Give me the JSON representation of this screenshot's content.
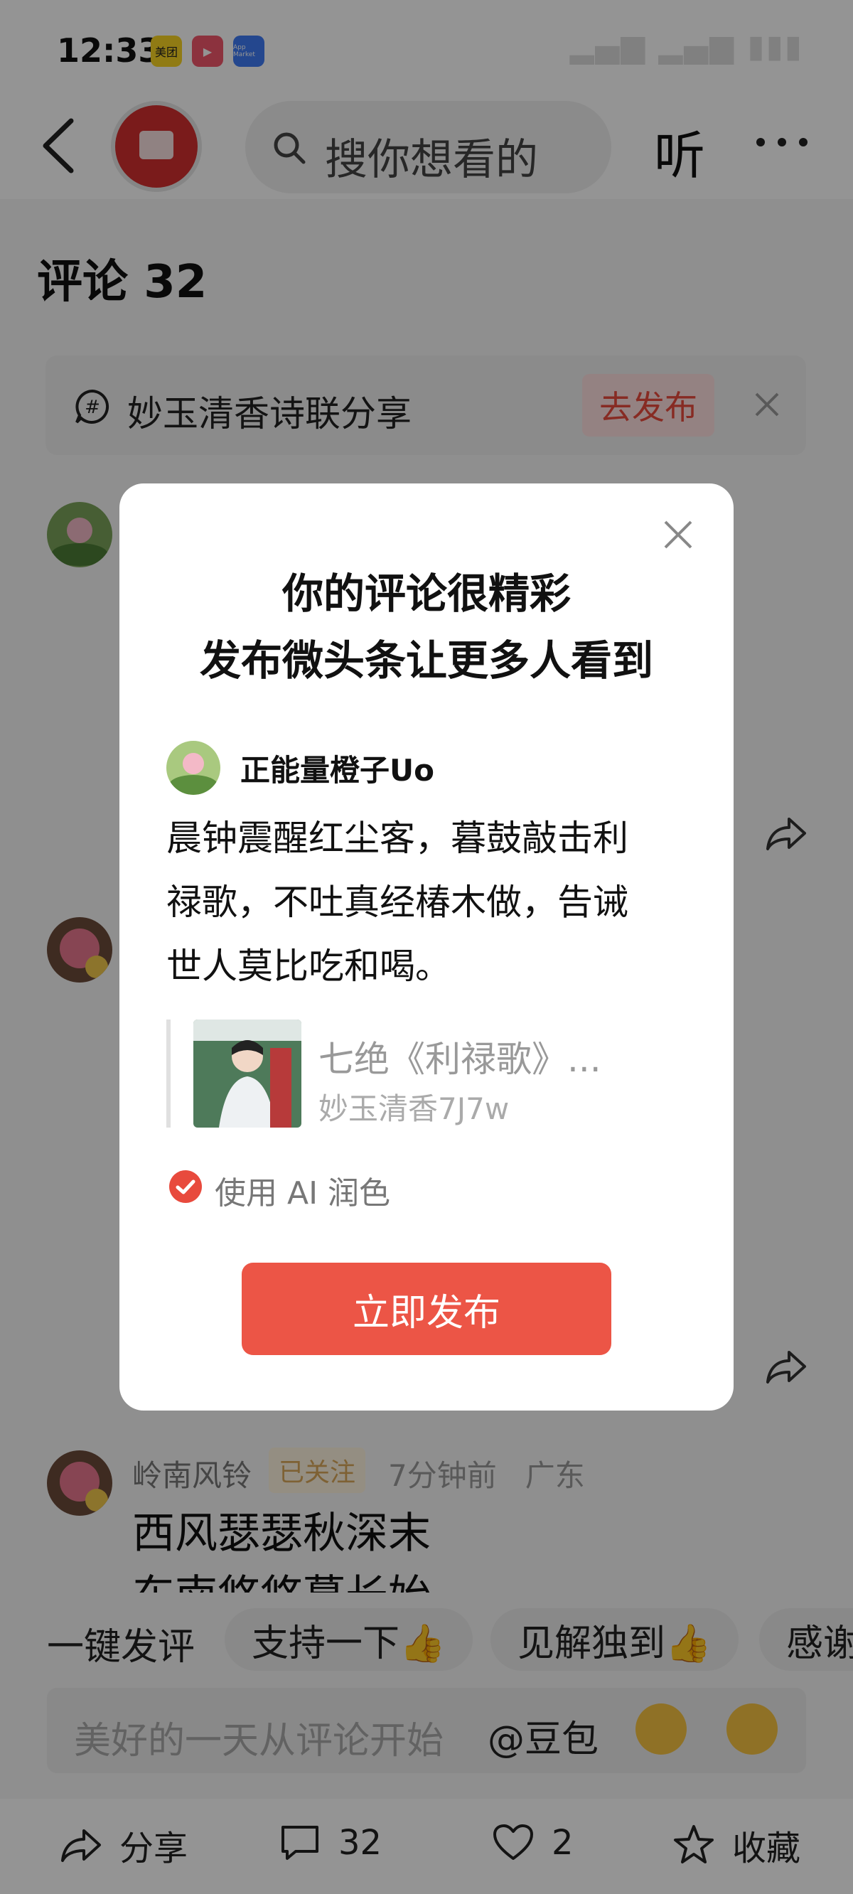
{
  "status_bar": {
    "time": "12:33",
    "apps": [
      "美团",
      "▶",
      "App Market"
    ]
  },
  "header": {
    "search_placeholder": "搜你想看的",
    "listen_label": "听"
  },
  "comments": {
    "title": "评论 32"
  },
  "topic": {
    "text": "妙玉清香诗联分享",
    "publish_label": "去发布"
  },
  "visible_comment": {
    "user": "岭南风铃",
    "follow_badge": "已关注",
    "time": "7分钟前",
    "location": "广东",
    "line1": "西风瑟瑟秋深末",
    "line2": "东南悠悠暮长始"
  },
  "quick_reply": {
    "label": "一键发评",
    "chips": [
      "支持一下👍",
      "见解独到👍",
      "感谢"
    ]
  },
  "input": {
    "placeholder": "美好的一天从评论开始",
    "mention": "@豆包"
  },
  "bottom_bar": {
    "share": "分享",
    "comments_count": "32",
    "likes": "2",
    "favorite": "收藏"
  },
  "modal": {
    "title_line1": "你的评论很精彩",
    "title_line2": "发布微头条让更多人看到",
    "username": "正能量橙子Uo",
    "text_line1": "晨钟震醒红尘客，暮鼓敲击利",
    "text_line2": "禄歌，不吐真经椿木做，告诫",
    "text_line3": "世人莫比吃和喝。",
    "article_title": "七绝《利禄歌》...",
    "article_author": "妙玉清香7J7w",
    "ai_option": "使用 AI 润色",
    "ai_checked": true,
    "publish_button": "立即发布",
    "accent_color": "#ec5546"
  }
}
